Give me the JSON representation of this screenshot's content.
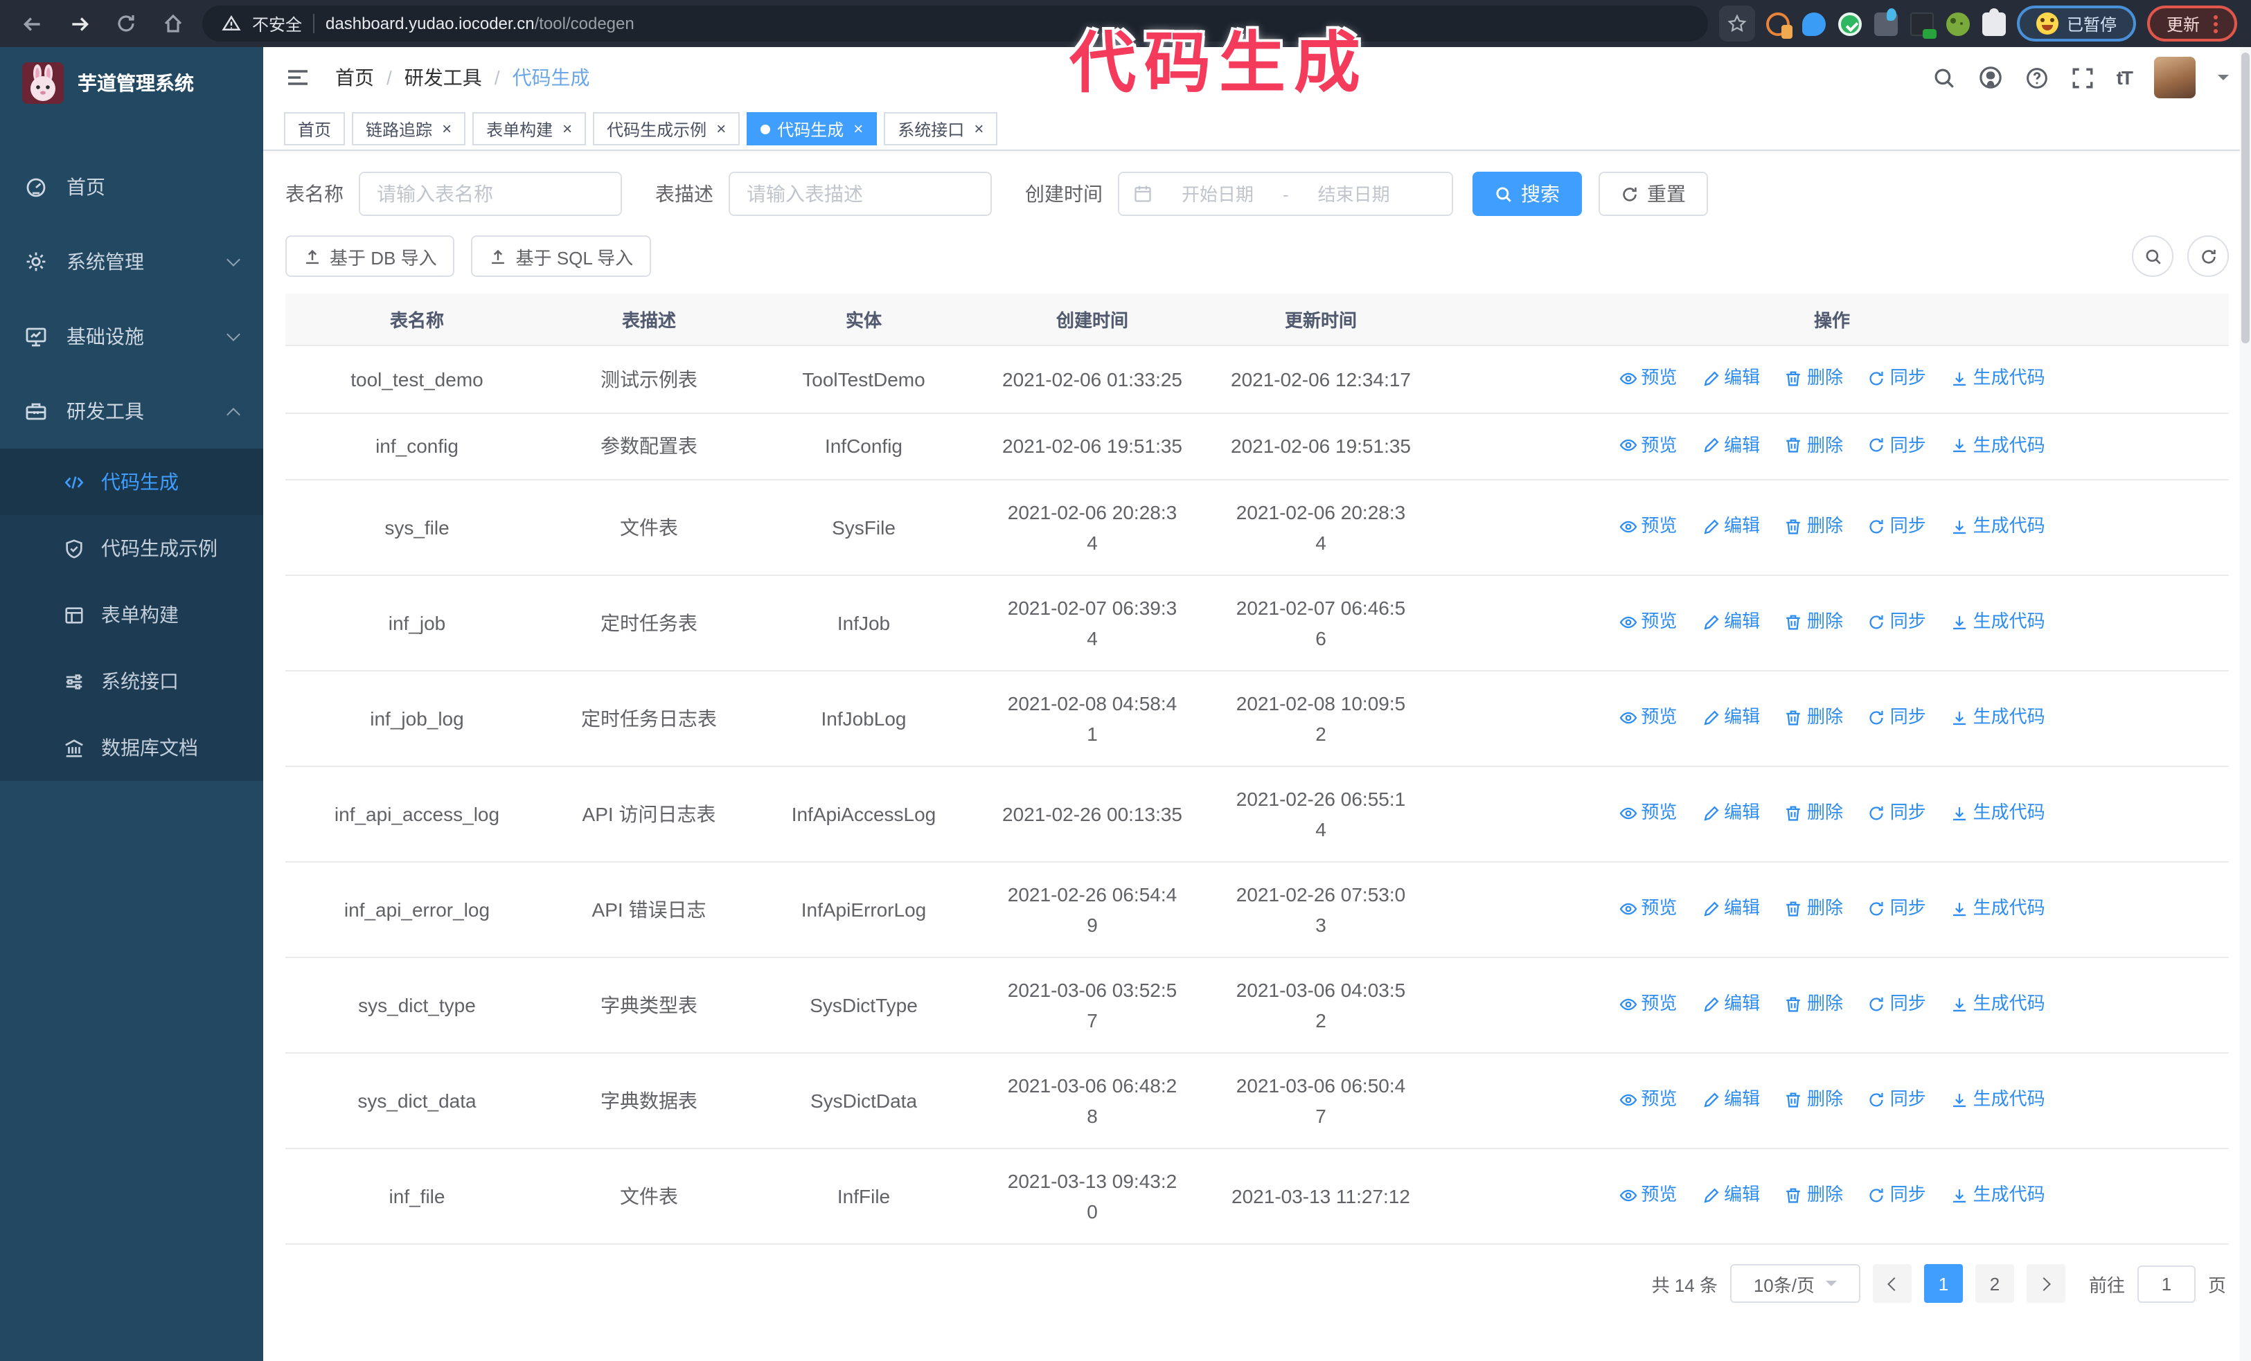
{
  "browser": {
    "security_label": "不安全",
    "url_domain": "dashboard.yudao.iocoder.cn",
    "url_path": "/tool/codegen",
    "paused_badge_label": "已暂停",
    "update_button_label": "更新"
  },
  "annotation": {
    "text": "代码生成",
    "color": "#f43b5c"
  },
  "sidebar": {
    "title": "芋道管理系统",
    "menu": [
      {
        "label": "首页"
      },
      {
        "label": "系统管理"
      },
      {
        "label": "基础设施"
      },
      {
        "label": "研发工具"
      }
    ],
    "submenu": [
      {
        "label": "代码生成",
        "active": true
      },
      {
        "label": "代码生成示例"
      },
      {
        "label": "表单构建"
      },
      {
        "label": "系统接口"
      },
      {
        "label": "数据库文档"
      }
    ]
  },
  "navbar": {
    "breadcrumb": [
      "首页",
      "研发工具",
      "代码生成"
    ]
  },
  "tabs": [
    {
      "label": "首页"
    },
    {
      "label": "链路追踪"
    },
    {
      "label": "表单构建"
    },
    {
      "label": "代码生成示例"
    },
    {
      "label": "代码生成",
      "active": true
    },
    {
      "label": "系统接口"
    }
  ],
  "filters": {
    "table_name_label": "表名称",
    "table_name_placeholder": "请输入表名称",
    "table_desc_label": "表描述",
    "table_desc_placeholder": "请输入表描述",
    "create_time_label": "创建时间",
    "start_date_placeholder": "开始日期",
    "range_separator": "-",
    "end_date_placeholder": "结束日期",
    "search_button": "搜索",
    "reset_button": "重置"
  },
  "toolbar": {
    "import_db_button": "基于 DB 导入",
    "import_sql_button": "基于 SQL 导入"
  },
  "table": {
    "columns": [
      "表名称",
      "表描述",
      "实体",
      "创建时间",
      "更新时间",
      "操作"
    ],
    "actions": [
      "预览",
      "编辑",
      "删除",
      "同步",
      "生成代码"
    ],
    "rows": [
      {
        "name": "tool_test_demo",
        "desc": "测试示例表",
        "entity": "ToolTestDemo",
        "created": "2021-02-06 01:33:25",
        "updated": "2021-02-06 12:34:17"
      },
      {
        "name": "inf_config",
        "desc": "参数配置表",
        "entity": "InfConfig",
        "created": "2021-02-06 19:51:35",
        "updated": "2021-02-06 19:51:35"
      },
      {
        "name": "sys_file",
        "desc": "文件表",
        "entity": "SysFile",
        "created": "2021-02-06 20:28:3\n4",
        "updated": "2021-02-06 20:28:3\n4"
      },
      {
        "name": "inf_job",
        "desc": "定时任务表",
        "entity": "InfJob",
        "created": "2021-02-07 06:39:3\n4",
        "updated": "2021-02-07 06:46:5\n6"
      },
      {
        "name": "inf_job_log",
        "desc": "定时任务日志表",
        "entity": "InfJobLog",
        "created": "2021-02-08 04:58:4\n1",
        "updated": "2021-02-08 10:09:5\n2"
      },
      {
        "name": "inf_api_access_log",
        "desc": "API 访问日志表",
        "entity": "InfApiAccessLog",
        "created": "2021-02-26 00:13:35",
        "updated": "2021-02-26 06:55:1\n4"
      },
      {
        "name": "inf_api_error_log",
        "desc": "API 错误日志",
        "entity": "InfApiErrorLog",
        "created": "2021-02-26 06:54:4\n9",
        "updated": "2021-02-26 07:53:0\n3"
      },
      {
        "name": "sys_dict_type",
        "desc": "字典类型表",
        "entity": "SysDictType",
        "created": "2021-03-06 03:52:5\n7",
        "updated": "2021-03-06 04:03:5\n2"
      },
      {
        "name": "sys_dict_data",
        "desc": "字典数据表",
        "entity": "SysDictData",
        "created": "2021-03-06 06:48:2\n8",
        "updated": "2021-03-06 06:50:4\n7"
      },
      {
        "name": "inf_file",
        "desc": "文件表",
        "entity": "InfFile",
        "created": "2021-03-13 09:43:2\n0",
        "updated": "2021-03-13 11:27:12"
      }
    ]
  },
  "pagination": {
    "total_label": "共 14 条",
    "page_size_label": "10条/页",
    "pages": [
      "1",
      "2"
    ],
    "active_page": "1",
    "goto_label": "前往",
    "goto_value": "1",
    "goto_suffix": "页"
  },
  "colors": {
    "primary": "#409eff",
    "sidebar_bg": "#234862",
    "link": "#2d8cf0",
    "annotation": "#f43b5c",
    "tab_active": "#409eff"
  }
}
